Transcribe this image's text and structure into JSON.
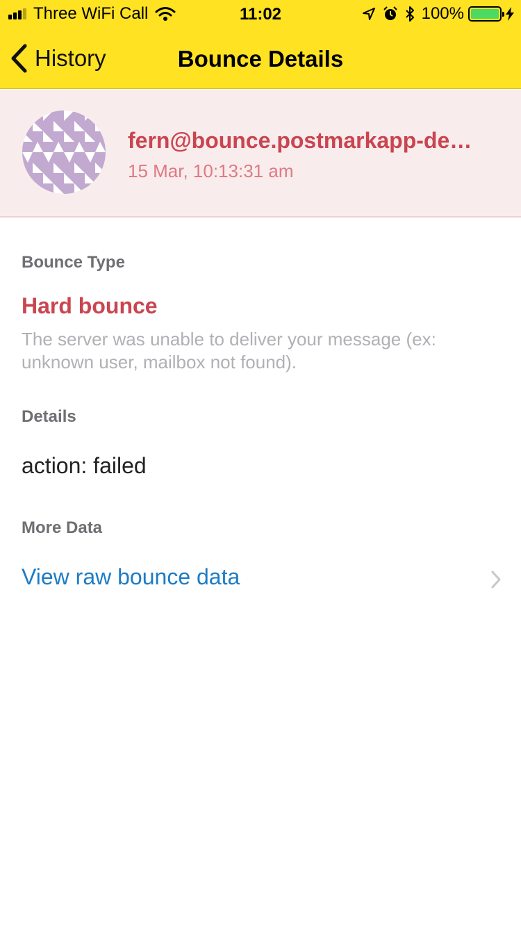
{
  "status_bar": {
    "carrier": "Three WiFi Call",
    "time": "11:02",
    "battery_percent": "100%",
    "battery_level": 1.0,
    "icons": [
      "signal-icon",
      "wifi-icon",
      "location-arrow-icon",
      "alarm-icon",
      "bluetooth-icon",
      "battery-icon",
      "charging-bolt-icon"
    ]
  },
  "nav": {
    "back_label": "History",
    "title": "Bounce Details",
    "back_icon": "chevron-left-icon"
  },
  "bounce": {
    "email": "fern@bounce.postmarkapp-de…",
    "timestamp": "15 Mar, 10:13:31 am"
  },
  "sections": {
    "bounce_type_label": "Bounce Type",
    "bounce_type_value": "Hard bounce",
    "bounce_type_description": "The server was unable to deliver your message (ex: unknown user, mailbox not found).",
    "details_label": "Details",
    "details_value": "action: failed",
    "more_data_label": "More Data",
    "view_raw_label": "View raw bounce data"
  },
  "colors": {
    "nav_background": "#FFE222",
    "header_background": "#F9ECEC",
    "error_red": "#C94550",
    "link_blue": "#1C7CC7",
    "avatar_purple": "#C2A9D0"
  }
}
